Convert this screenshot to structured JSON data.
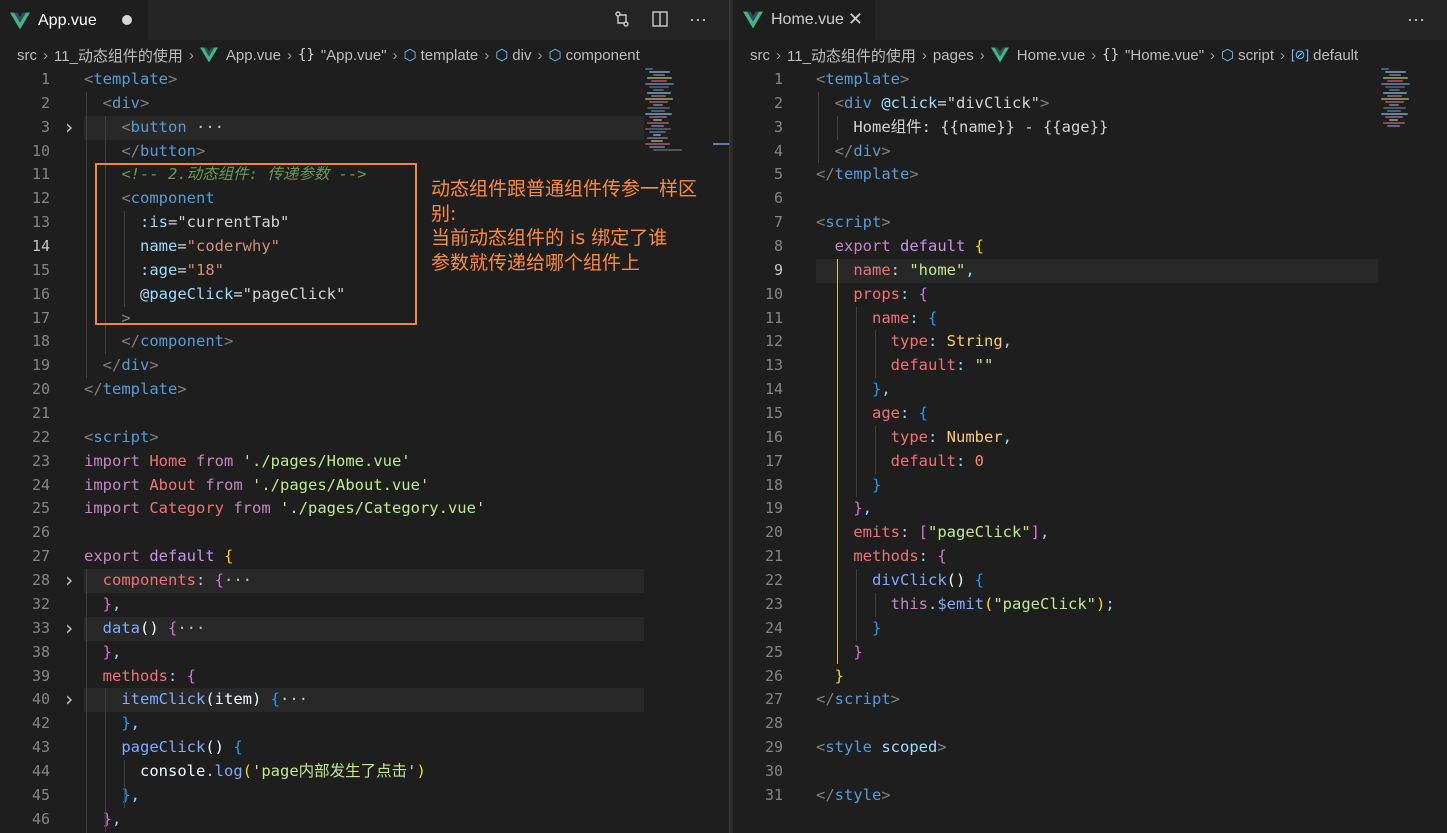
{
  "left": {
    "tab": {
      "label": "App.vue",
      "modified": true
    },
    "actions": [
      "open-changes-icon",
      "split-editor-icon",
      "more-actions-icon"
    ],
    "breadcrumb": [
      "src",
      "11_动态组件的使用",
      "App.vue",
      "\"App.vue\"",
      "template",
      "div",
      "component"
    ],
    "lines": [
      {
        "n": "1",
        "fold": false,
        "segs": [
          [
            "<",
            "br"
          ],
          [
            "template",
            "tag"
          ],
          [
            ">",
            "br"
          ]
        ]
      },
      {
        "n": "2",
        "fold": false,
        "segs": [
          [
            "  ",
            "txt"
          ],
          [
            "<",
            "br"
          ],
          [
            "div",
            "tag"
          ],
          [
            ">",
            "br"
          ]
        ]
      },
      {
        "n": "3",
        "fold": true,
        "hl": true,
        "segs": [
          [
            "    ",
            "txt"
          ],
          [
            "<",
            "br"
          ],
          [
            "button",
            "tag"
          ],
          [
            " ···",
            "fold"
          ]
        ]
      },
      {
        "n": "10",
        "fold": false,
        "segs": [
          [
            "    ",
            "txt"
          ],
          [
            "</",
            "br"
          ],
          [
            "button",
            "tag"
          ],
          [
            ">",
            "br"
          ]
        ]
      },
      {
        "n": "11",
        "fold": false,
        "segs": [
          [
            "    ",
            "txt"
          ],
          [
            "<!-- 2.动态组件: 传递参数 -->",
            "cmt"
          ]
        ]
      },
      {
        "n": "12",
        "fold": false,
        "segs": [
          [
            "    ",
            "txt"
          ],
          [
            "<",
            "br"
          ],
          [
            "component",
            "tag"
          ]
        ]
      },
      {
        "n": "13",
        "fold": false,
        "segs": [
          [
            "      ",
            "txt"
          ],
          [
            ":is",
            "attr"
          ],
          [
            "=",
            "txt"
          ],
          [
            "\"currentTab\"",
            "txt"
          ]
        ]
      },
      {
        "n": "14",
        "active": true,
        "fold": false,
        "segs": [
          [
            "      ",
            "txt"
          ],
          [
            "name",
            "attr"
          ],
          [
            "=",
            "txt"
          ],
          [
            "\"coderwhy\"",
            "str"
          ]
        ]
      },
      {
        "n": "15",
        "fold": false,
        "segs": [
          [
            "      ",
            "txt"
          ],
          [
            ":age",
            "attr"
          ],
          [
            "=",
            "txt"
          ],
          [
            "\"18\"",
            "str"
          ]
        ]
      },
      {
        "n": "16",
        "fold": false,
        "segs": [
          [
            "      ",
            "txt"
          ],
          [
            "@pageClick",
            "attr"
          ],
          [
            "=",
            "txt"
          ],
          [
            "\"pageClick\"",
            "txt"
          ]
        ]
      },
      {
        "n": "17",
        "fold": false,
        "segs": [
          [
            "    ",
            "txt"
          ],
          [
            ">",
            "br"
          ]
        ]
      },
      {
        "n": "18",
        "fold": false,
        "segs": [
          [
            "    ",
            "txt"
          ],
          [
            "</",
            "br"
          ],
          [
            "component",
            "tag"
          ],
          [
            ">",
            "br"
          ]
        ]
      },
      {
        "n": "19",
        "fold": false,
        "segs": [
          [
            "  ",
            "txt"
          ],
          [
            "</",
            "br"
          ],
          [
            "div",
            "tag"
          ],
          [
            ">",
            "br"
          ]
        ]
      },
      {
        "n": "20",
        "fold": false,
        "segs": [
          [
            "</",
            "br"
          ],
          [
            "template",
            "tag"
          ],
          [
            ">",
            "br"
          ]
        ]
      },
      {
        "n": "21",
        "fold": false,
        "segs": []
      },
      {
        "n": "22",
        "fold": false,
        "segs": [
          [
            "<",
            "br"
          ],
          [
            "script",
            "tag"
          ],
          [
            ">",
            "br"
          ]
        ]
      },
      {
        "n": "23",
        "fold": false,
        "segs": [
          [
            "import ",
            "kw"
          ],
          [
            "Home ",
            "var"
          ],
          [
            "from ",
            "kw"
          ],
          [
            "'./pages/Home.vue'",
            "jstr"
          ]
        ]
      },
      {
        "n": "24",
        "fold": false,
        "segs": [
          [
            "import ",
            "kw"
          ],
          [
            "About ",
            "var"
          ],
          [
            "from ",
            "kw"
          ],
          [
            "'./pages/About.vue'",
            "jstr"
          ]
        ]
      },
      {
        "n": "25",
        "fold": false,
        "segs": [
          [
            "import ",
            "kw"
          ],
          [
            "Category ",
            "var"
          ],
          [
            "from ",
            "kw"
          ],
          [
            "'./pages/Category.vue'",
            "jstr"
          ]
        ]
      },
      {
        "n": "26",
        "fold": false,
        "segs": []
      },
      {
        "n": "27",
        "fold": false,
        "segs": [
          [
            "export ",
            "kw"
          ],
          [
            "default ",
            "def"
          ],
          [
            "{",
            "br1"
          ]
        ]
      },
      {
        "n": "28",
        "fold": true,
        "hl": true,
        "segs": [
          [
            "  ",
            "txt"
          ],
          [
            "components",
            "prop"
          ],
          [
            ": ",
            "pun"
          ],
          [
            "{",
            "br2"
          ],
          [
            "···",
            "fold"
          ]
        ]
      },
      {
        "n": "32",
        "fold": false,
        "segs": [
          [
            "  ",
            "txt"
          ],
          [
            "}",
            "br2"
          ],
          [
            ",",
            "pun"
          ]
        ]
      },
      {
        "n": "33",
        "fold": true,
        "hl": true,
        "segs": [
          [
            "  ",
            "txt"
          ],
          [
            "data",
            "fn"
          ],
          [
            "() ",
            "plain"
          ],
          [
            "{",
            "br2"
          ],
          [
            "···",
            "fold"
          ]
        ]
      },
      {
        "n": "38",
        "fold": false,
        "segs": [
          [
            "  ",
            "txt"
          ],
          [
            "}",
            "br2"
          ],
          [
            ",",
            "pun"
          ]
        ]
      },
      {
        "n": "39",
        "fold": false,
        "segs": [
          [
            "  ",
            "txt"
          ],
          [
            "methods",
            "prop"
          ],
          [
            ": ",
            "pun"
          ],
          [
            "{",
            "br2"
          ]
        ]
      },
      {
        "n": "40",
        "fold": true,
        "hl": true,
        "segs": [
          [
            "    ",
            "txt"
          ],
          [
            "itemClick",
            "fn"
          ],
          [
            "(",
            "plain"
          ],
          [
            "item",
            "plain"
          ],
          [
            ") ",
            "plain"
          ],
          [
            "{",
            "br3"
          ],
          [
            "···",
            "fold"
          ]
        ]
      },
      {
        "n": "42",
        "fold": false,
        "segs": [
          [
            "    ",
            "txt"
          ],
          [
            "}",
            "br3"
          ],
          [
            ",",
            "pun"
          ]
        ]
      },
      {
        "n": "43",
        "fold": false,
        "segs": [
          [
            "    ",
            "txt"
          ],
          [
            "pageClick",
            "fn"
          ],
          [
            "() ",
            "plain"
          ],
          [
            "{",
            "br3"
          ]
        ]
      },
      {
        "n": "44",
        "fold": false,
        "segs": [
          [
            "      ",
            "txt"
          ],
          [
            "console",
            "plain"
          ],
          [
            ".",
            "pun"
          ],
          [
            "log",
            "fn"
          ],
          [
            "(",
            "br1"
          ],
          [
            "'page内部发生了点击'",
            "jstr"
          ],
          [
            ")",
            "br1"
          ]
        ]
      },
      {
        "n": "45",
        "fold": false,
        "segs": [
          [
            "    ",
            "txt"
          ],
          [
            "}",
            "br3"
          ],
          [
            ",",
            "pun"
          ]
        ]
      },
      {
        "n": "46",
        "fold": false,
        "segs": [
          [
            "  ",
            "txt"
          ],
          [
            "}",
            "br2"
          ],
          [
            ",",
            "pun"
          ]
        ]
      }
    ]
  },
  "annotation": {
    "text": "动态组件跟普通组件传参一样区别:\n当前动态组件的 is 绑定了谁\n参数就传递给哪个组件上"
  },
  "right": {
    "tab": {
      "label": "Home.vue"
    },
    "actions": [
      "more-actions-icon"
    ],
    "breadcrumb": [
      "src",
      "11_动态组件的使用",
      "pages",
      "Home.vue",
      "\"Home.vue\"",
      "script",
      "default"
    ],
    "lines": [
      {
        "n": "1",
        "segs": [
          [
            "<",
            "br"
          ],
          [
            "template",
            "tag"
          ],
          [
            ">",
            "br"
          ]
        ]
      },
      {
        "n": "2",
        "segs": [
          [
            "  ",
            "txt"
          ],
          [
            "<",
            "br"
          ],
          [
            "div ",
            "tag"
          ],
          [
            "@click",
            "attr"
          ],
          [
            "=",
            "txt"
          ],
          [
            "\"divClick\"",
            "txt"
          ],
          [
            ">",
            "br"
          ]
        ]
      },
      {
        "n": "3",
        "segs": [
          [
            "    ",
            "txt"
          ],
          [
            "Home组件: {{name}} - {{age}}",
            "txt"
          ]
        ]
      },
      {
        "n": "4",
        "segs": [
          [
            "  ",
            "txt"
          ],
          [
            "</",
            "br"
          ],
          [
            "div",
            "tag"
          ],
          [
            ">",
            "br"
          ]
        ]
      },
      {
        "n": "5",
        "segs": [
          [
            "</",
            "br"
          ],
          [
            "template",
            "tag"
          ],
          [
            ">",
            "br"
          ]
        ]
      },
      {
        "n": "6",
        "segs": []
      },
      {
        "n": "7",
        "segs": [
          [
            "<",
            "br"
          ],
          [
            "script",
            "tag"
          ],
          [
            ">",
            "br"
          ]
        ]
      },
      {
        "n": "8",
        "segs": [
          [
            "  ",
            "txt"
          ],
          [
            "export ",
            "kw"
          ],
          [
            "default ",
            "def"
          ],
          [
            "{",
            "br1"
          ]
        ]
      },
      {
        "n": "9",
        "active": true,
        "hl": true,
        "segs": [
          [
            "    ",
            "txt"
          ],
          [
            "name",
            "prop"
          ],
          [
            ": ",
            "pun"
          ],
          [
            "\"home\"",
            "jstr"
          ],
          [
            ",",
            "pun"
          ]
        ]
      },
      {
        "n": "10",
        "segs": [
          [
            "    ",
            "txt"
          ],
          [
            "props",
            "prop"
          ],
          [
            ": ",
            "pun"
          ],
          [
            "{",
            "br2"
          ]
        ]
      },
      {
        "n": "11",
        "segs": [
          [
            "      ",
            "txt"
          ],
          [
            "name",
            "prop"
          ],
          [
            ": ",
            "pun"
          ],
          [
            "{",
            "br3"
          ]
        ]
      },
      {
        "n": "12",
        "segs": [
          [
            "        ",
            "txt"
          ],
          [
            "type",
            "prop"
          ],
          [
            ": ",
            "pun"
          ],
          [
            "String",
            "typ"
          ],
          [
            ",",
            "pun"
          ]
        ]
      },
      {
        "n": "13",
        "segs": [
          [
            "        ",
            "txt"
          ],
          [
            "default",
            "prop"
          ],
          [
            ": ",
            "pun"
          ],
          [
            "\"\"",
            "jstr"
          ]
        ]
      },
      {
        "n": "14",
        "segs": [
          [
            "      ",
            "txt"
          ],
          [
            "}",
            "br3"
          ],
          [
            ",",
            "pun"
          ]
        ]
      },
      {
        "n": "15",
        "segs": [
          [
            "      ",
            "txt"
          ],
          [
            "age",
            "prop"
          ],
          [
            ": ",
            "pun"
          ],
          [
            "{",
            "br3"
          ]
        ]
      },
      {
        "n": "16",
        "segs": [
          [
            "        ",
            "txt"
          ],
          [
            "type",
            "prop"
          ],
          [
            ": ",
            "pun"
          ],
          [
            "Number",
            "typ"
          ],
          [
            ",",
            "pun"
          ]
        ]
      },
      {
        "n": "17",
        "segs": [
          [
            "        ",
            "txt"
          ],
          [
            "default",
            "prop"
          ],
          [
            ": ",
            "pun"
          ],
          [
            "0",
            "num"
          ]
        ]
      },
      {
        "n": "18",
        "segs": [
          [
            "      ",
            "txt"
          ],
          [
            "}",
            "br3"
          ]
        ]
      },
      {
        "n": "19",
        "segs": [
          [
            "    ",
            "txt"
          ],
          [
            "}",
            "br2"
          ],
          [
            ",",
            "pun"
          ]
        ]
      },
      {
        "n": "20",
        "segs": [
          [
            "    ",
            "txt"
          ],
          [
            "emits",
            "prop"
          ],
          [
            ": ",
            "pun"
          ],
          [
            "[",
            "br2"
          ],
          [
            "\"pageClick\"",
            "jstr"
          ],
          [
            "]",
            "br2"
          ],
          [
            ",",
            "pun"
          ]
        ]
      },
      {
        "n": "21",
        "segs": [
          [
            "    ",
            "txt"
          ],
          [
            "methods",
            "prop"
          ],
          [
            ": ",
            "pun"
          ],
          [
            "{",
            "br2"
          ]
        ]
      },
      {
        "n": "22",
        "segs": [
          [
            "      ",
            "txt"
          ],
          [
            "divClick",
            "fn"
          ],
          [
            "() ",
            "plain"
          ],
          [
            "{",
            "br3"
          ]
        ]
      },
      {
        "n": "23",
        "segs": [
          [
            "        ",
            "txt"
          ],
          [
            "this",
            "kw"
          ],
          [
            ".",
            "pun"
          ],
          [
            "$emit",
            "fn"
          ],
          [
            "(",
            "br1"
          ],
          [
            "\"pageClick\"",
            "jstr"
          ],
          [
            ")",
            "br1"
          ],
          [
            ";",
            "pun"
          ]
        ]
      },
      {
        "n": "24",
        "segs": [
          [
            "      ",
            "txt"
          ],
          [
            "}",
            "br3"
          ]
        ]
      },
      {
        "n": "25",
        "segs": [
          [
            "    ",
            "txt"
          ],
          [
            "}",
            "br2"
          ]
        ]
      },
      {
        "n": "26",
        "segs": [
          [
            "  ",
            "txt"
          ],
          [
            "}",
            "br1"
          ]
        ]
      },
      {
        "n": "27",
        "segs": [
          [
            "</",
            "br"
          ],
          [
            "script",
            "tag"
          ],
          [
            ">",
            "br"
          ]
        ]
      },
      {
        "n": "28",
        "segs": []
      },
      {
        "n": "29",
        "segs": [
          [
            "<",
            "br"
          ],
          [
            "style ",
            "tag"
          ],
          [
            "scoped",
            "attr"
          ],
          [
            ">",
            "br"
          ]
        ]
      },
      {
        "n": "30",
        "segs": []
      },
      {
        "n": "31",
        "segs": [
          [
            "</",
            "br"
          ],
          [
            "style",
            "tag"
          ],
          [
            ">",
            "br"
          ]
        ]
      }
    ]
  },
  "colors": {
    "background": "#1e1e1e",
    "accent_annotation": "#f08b2b",
    "vue_green": "#41b883"
  }
}
